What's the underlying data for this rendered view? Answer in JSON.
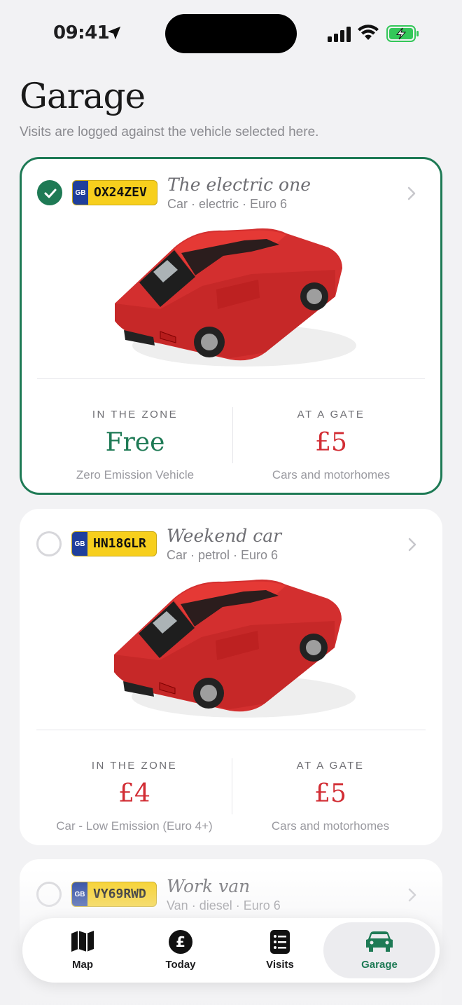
{
  "status_bar": {
    "time": "09:41"
  },
  "page": {
    "title": "Garage",
    "subtitle": "Visits are logged against the vehicle selected here."
  },
  "vehicles": [
    {
      "selected": true,
      "plate_country": "GB",
      "registration": "OX24ZEV",
      "nickname": "The electric one",
      "meta": "Car · electric · Euro 6",
      "zone_label": "IN THE ZONE",
      "zone_amount": "Free",
      "zone_note": "Zero Emission Vehicle",
      "gate_label": "AT A GATE",
      "gate_amount": "£5",
      "gate_note": "Cars and motorhomes"
    },
    {
      "selected": false,
      "plate_country": "GB",
      "registration": "HN18GLR",
      "nickname": "Weekend car",
      "meta": "Car · petrol · Euro 6",
      "zone_label": "IN THE ZONE",
      "zone_amount": "£4",
      "zone_note": "Car - Low Emission (Euro 4+)",
      "gate_label": "AT A GATE",
      "gate_amount": "£5",
      "gate_note": "Cars and motorhomes"
    },
    {
      "selected": false,
      "plate_country": "GB",
      "registration": "VY69RWD",
      "nickname": "Work van",
      "meta": "Van · diesel · Euro 6"
    }
  ],
  "tab_bar": {
    "items": [
      {
        "label": "Map",
        "icon": "map-icon"
      },
      {
        "label": "Today",
        "icon": "pound-icon"
      },
      {
        "label": "Visits",
        "icon": "list-icon"
      },
      {
        "label": "Garage",
        "icon": "car-icon"
      }
    ],
    "active": "Garage"
  },
  "colors": {
    "accent": "#1e7a55",
    "price": "#d22d34",
    "plate_yellow": "#f7cf1d",
    "plate_blue": "#1f3f9c"
  }
}
